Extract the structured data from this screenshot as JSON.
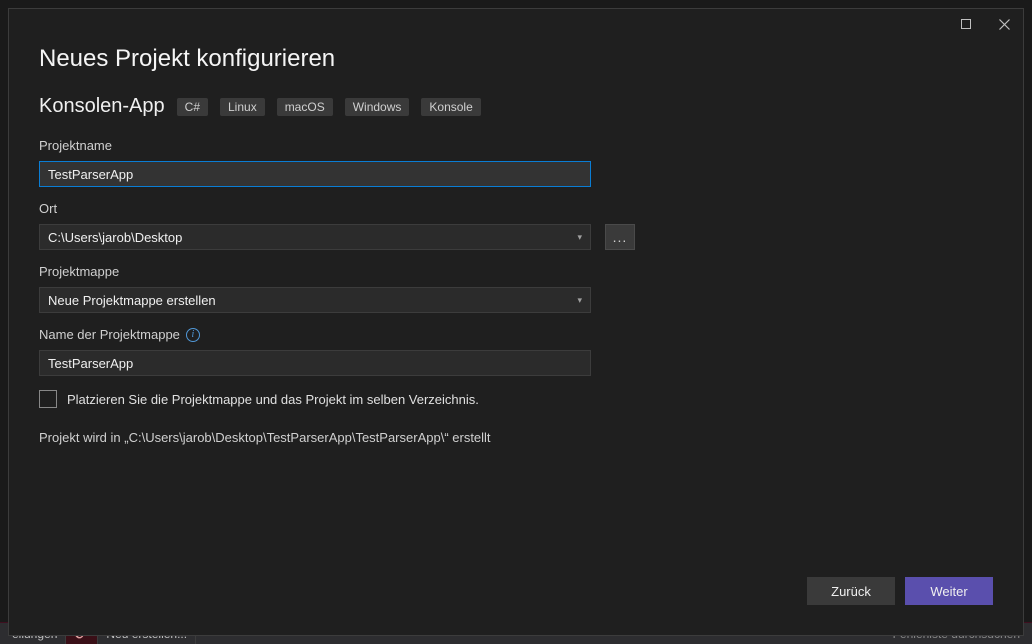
{
  "titlebar": {
    "maximize_tooltip": "Maximize",
    "close_tooltip": "Close"
  },
  "page": {
    "title": "Neues Projekt konfigurieren"
  },
  "subheader": {
    "template_name": "Konsolen-App",
    "tags": [
      "C#",
      "Linux",
      "macOS",
      "Windows",
      "Konsole"
    ]
  },
  "fields": {
    "project_name_label": "Projektname",
    "project_name_value": "TestParserApp",
    "location_label": "Ort",
    "location_value": "C:\\Users\\jarob\\Desktop",
    "browse_label": "...",
    "solution_label": "Projektmappe",
    "solution_value": "Neue Projektmappe erstellen",
    "solution_name_label": "Name der Projektmappe",
    "solution_name_value": "TestParserApp",
    "same_dir_checkbox_label": "Platzieren Sie die Projektmappe und das Projekt im selben Verzeichnis."
  },
  "status": {
    "creation_path": "Projekt wird in „C:\\Users\\jarob\\Desktop\\TestParserApp\\TestParserApp\\“ erstellt"
  },
  "footer": {
    "back_label": "Zurück",
    "next_label": "Weiter"
  },
  "statusbar": {
    "left1": "eilungen",
    "left2_icon": "⊘⁷",
    "left3": "Neu erstellen...",
    "right": "Fehlerliste durchsuchen"
  }
}
